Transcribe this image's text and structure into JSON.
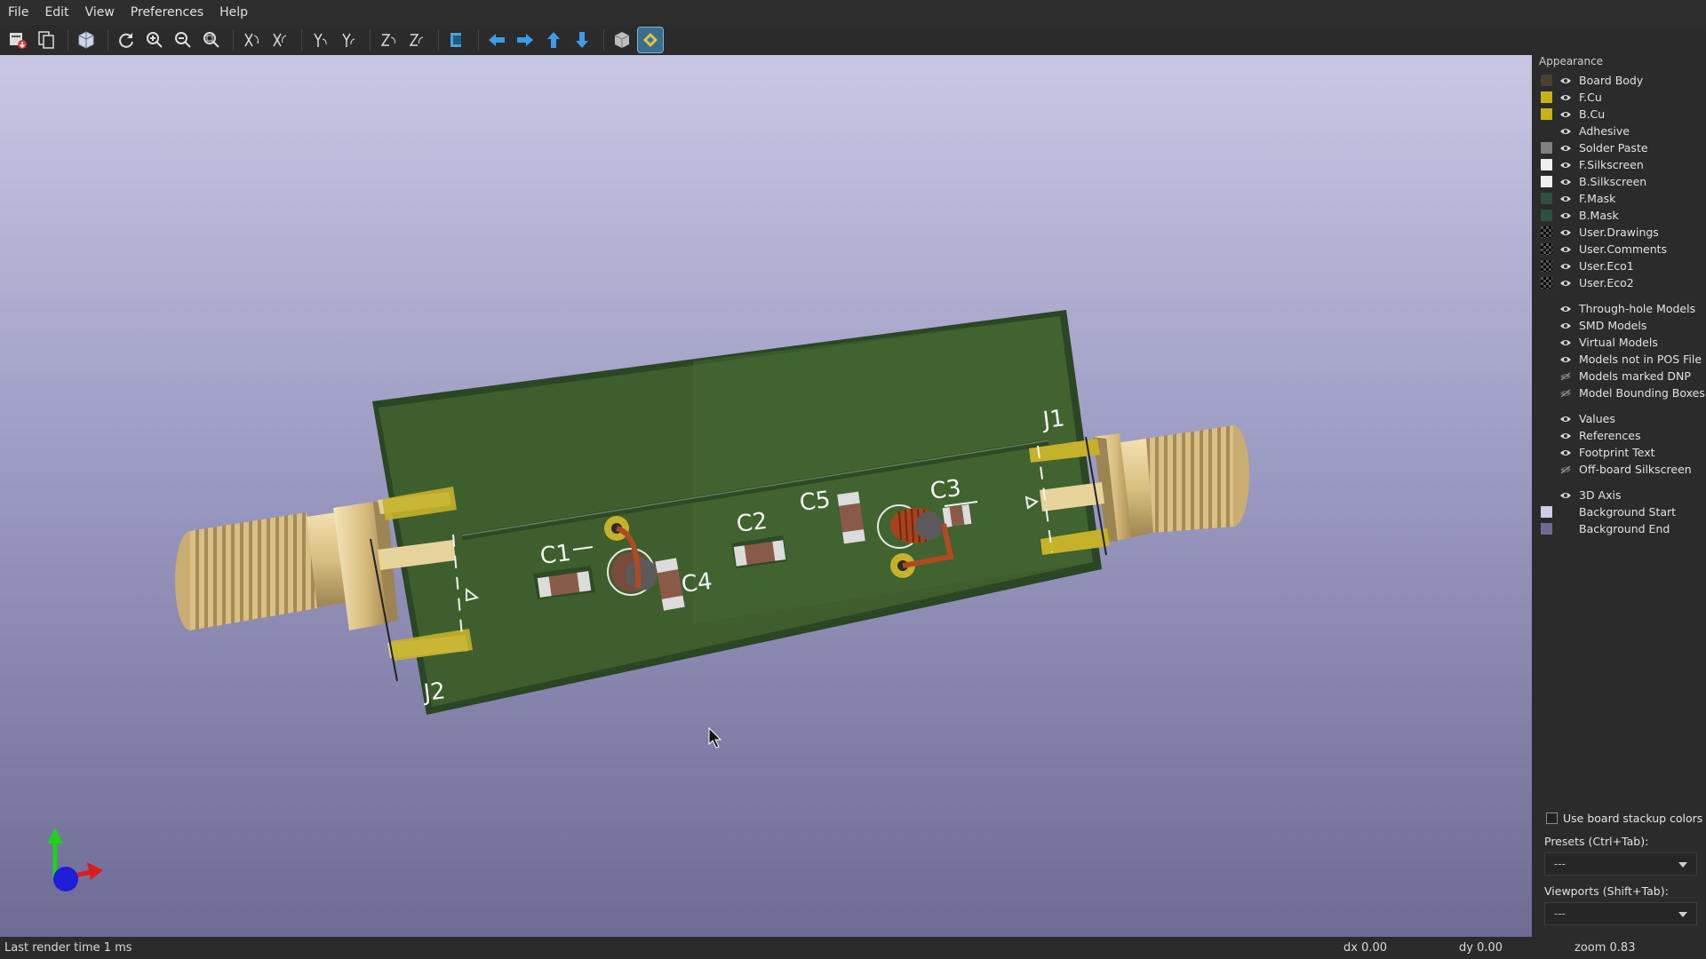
{
  "menu": [
    "File",
    "Edit",
    "View",
    "Preferences",
    "Help"
  ],
  "appearance": {
    "title": "Appearance",
    "layers": [
      {
        "label": "Board Body",
        "color": "#4a4030"
      },
      {
        "label": "F.Cu",
        "color": "#c8b418"
      },
      {
        "label": "B.Cu",
        "color": "#c8b418"
      },
      {
        "label": "Adhesive",
        "color": ""
      },
      {
        "label": "Solder Paste",
        "color": "#808080"
      },
      {
        "label": "F.Silkscreen",
        "color": "#f0f0f0"
      },
      {
        "label": "B.Silkscreen",
        "color": "#f0f0f0"
      },
      {
        "label": "F.Mask",
        "color": "#2e5040"
      },
      {
        "label": "B.Mask",
        "color": "#2e5040"
      },
      {
        "label": "User.Drawings",
        "color": "checker"
      },
      {
        "label": "User.Comments",
        "color": "checker"
      },
      {
        "label": "User.Eco1",
        "color": "checker"
      },
      {
        "label": "User.Eco2",
        "color": "checker"
      }
    ],
    "models": [
      {
        "label": "Through-hole Models",
        "visible": true
      },
      {
        "label": "SMD Models",
        "visible": true
      },
      {
        "label": "Virtual Models",
        "visible": true
      },
      {
        "label": "Models not in POS File",
        "visible": true
      },
      {
        "label": "Models marked DNP",
        "visible": false
      },
      {
        "label": "Model Bounding Boxes",
        "visible": false
      }
    ],
    "text_items": [
      {
        "label": "Values",
        "visible": true
      },
      {
        "label": "References",
        "visible": true
      },
      {
        "label": "Footprint Text",
        "visible": true
      },
      {
        "label": "Off-board Silkscreen",
        "visible": false
      }
    ],
    "misc": [
      {
        "label": "3D Axis",
        "color": ""
      },
      {
        "label": "Background Start",
        "color": "#cfcde8"
      },
      {
        "label": "Background End",
        "color": "#6e6b95"
      }
    ],
    "use_stackup_label": "Use board stackup colors",
    "presets_label": "Presets (Ctrl+Tab):",
    "presets_value": "---",
    "viewports_label": "Viewports (Shift+Tab):",
    "viewports_value": "---"
  },
  "board": {
    "references": [
      "J1",
      "J2",
      "C1",
      "C2",
      "C3",
      "C4",
      "C5"
    ]
  },
  "status": {
    "render_time": "Last render time 1 ms",
    "dx": "dx 0.00",
    "dy": "dy 0.00",
    "zoom": "zoom 0.83"
  }
}
